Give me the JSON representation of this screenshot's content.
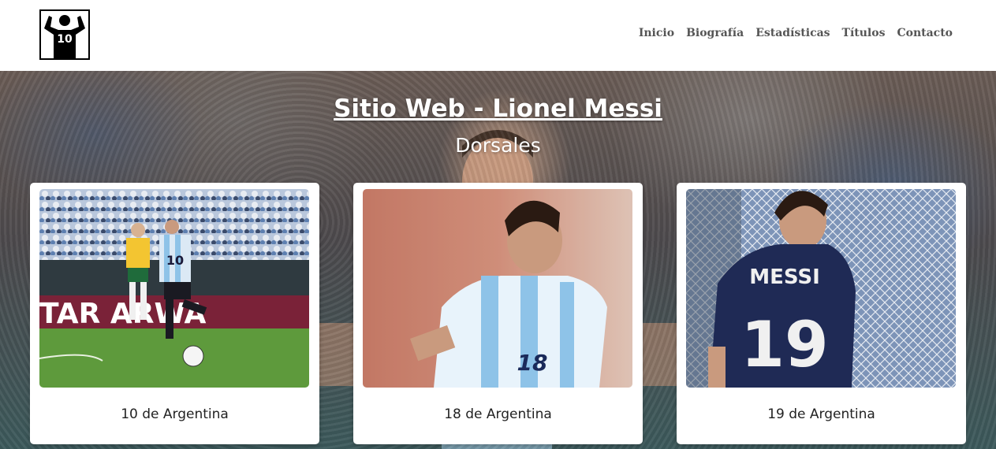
{
  "nav": {
    "items": [
      {
        "label": "Inicio"
      },
      {
        "label": "Biografía"
      },
      {
        "label": "Estadísticas"
      },
      {
        "label": "Títulos"
      },
      {
        "label": "Contacto"
      }
    ]
  },
  "logo": {
    "number": "10"
  },
  "hero": {
    "title": "Sitio Web - Lionel Messi",
    "subtitle": "Dorsales"
  },
  "cards": [
    {
      "caption": "10 de Argentina",
      "shirt_number": "10",
      "banner_text": "TAR  ARWA"
    },
    {
      "caption": "18 de Argentina",
      "shirt_number": "18"
    },
    {
      "caption": "19 de Argentina",
      "shirt_number": "19",
      "shirt_name": "MESSI"
    }
  ],
  "colors": {
    "nav_text": "#555555",
    "argentina_sky": "#9fd0ee",
    "away_navy": "#1f2a55"
  }
}
